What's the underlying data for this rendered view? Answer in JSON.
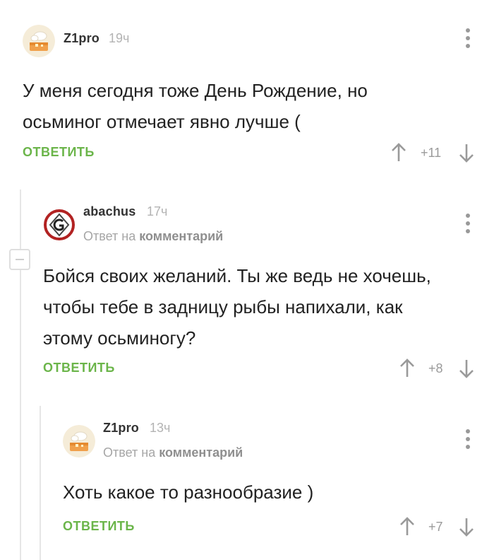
{
  "comments": [
    {
      "author": "Z1pro",
      "time": "19ч",
      "text_lines": [
        "У меня сегодня тоже День Рождение, но",
        "осьминог отмечает явно лучше ("
      ],
      "reply_label": "ОТВЕТИТЬ",
      "rating": "+11"
    },
    {
      "author": "abachus",
      "time": "17ч",
      "reply_prefix": "Ответ на",
      "reply_target": "комментарий",
      "text_lines": [
        "Бойся своих желаний. Ты же ведь не хочешь,",
        "чтобы тебе в задницу рыбы напихали, как",
        "этому осьминогу?"
      ],
      "reply_label": "ОТВЕТИТЬ",
      "rating": "+8"
    },
    {
      "author": "Z1pro",
      "time": "13ч",
      "reply_prefix": "Ответ на",
      "reply_target": "комментарий",
      "text_lines": [
        "Хоть какое то разнообразие )"
      ],
      "reply_label": "ОТВЕТИТЬ",
      "rating": "+7"
    }
  ],
  "colors": {
    "accent": "#6bb54a",
    "muted": "#b3b3b3",
    "thread_line": "#e6e6e6"
  },
  "icons": [
    "cake-avatar",
    "grooveshark-logo-avatar",
    "more-vertical-icon",
    "arrow-up-icon",
    "arrow-down-icon",
    "collapse-minus-icon"
  ]
}
